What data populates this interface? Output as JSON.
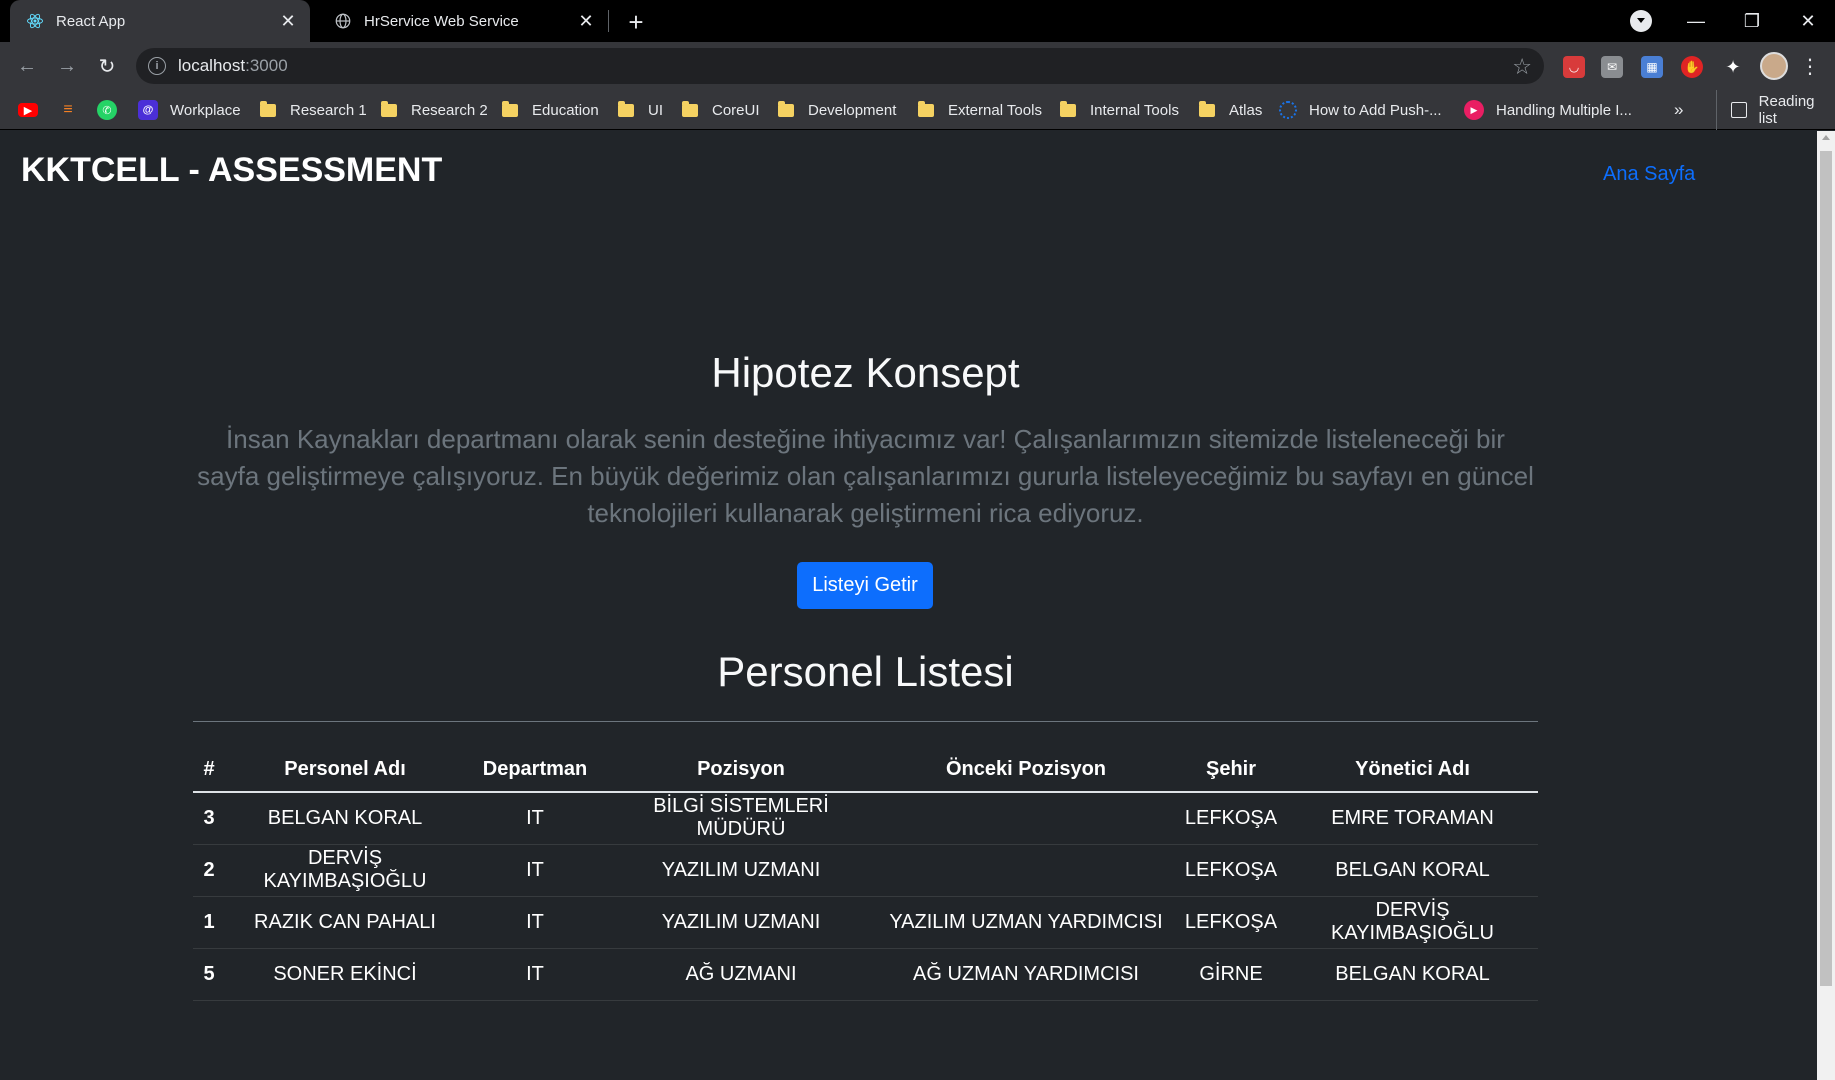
{
  "browser": {
    "tabs": [
      {
        "title": "React App",
        "active": true,
        "icon": "react-icon"
      },
      {
        "title": "HrService Web Service",
        "active": false,
        "icon": "globe-icon"
      }
    ],
    "url_host": "localhost",
    "url_port": ":3000",
    "bookmarks": [
      {
        "label": "",
        "icon": "youtube-icon",
        "color": "#ff0000"
      },
      {
        "label": "",
        "icon": "stackoverflow-icon",
        "color": "#f48024"
      },
      {
        "label": "",
        "icon": "whatsapp-icon",
        "color": "#25d366"
      },
      {
        "label": "Workplace",
        "icon": "workplace-icon",
        "color": "#4b2fd8"
      },
      {
        "label": "Research 1",
        "icon": "folder-icon"
      },
      {
        "label": "Research 2",
        "icon": "folder-icon"
      },
      {
        "label": "Education",
        "icon": "folder-icon"
      },
      {
        "label": "UI",
        "icon": "folder-icon"
      },
      {
        "label": "CoreUI",
        "icon": "folder-icon"
      },
      {
        "label": "Development",
        "icon": "folder-icon"
      },
      {
        "label": "External Tools",
        "icon": "folder-icon"
      },
      {
        "label": "Internal Tools",
        "icon": "folder-icon"
      },
      {
        "label": "Atlas",
        "icon": "folder-icon"
      },
      {
        "label": "How to Add Push-...",
        "icon": "spinner-icon",
        "color": "#1a73e8"
      },
      {
        "label": "Handling Multiple I...",
        "icon": "play-icon",
        "color": "#e91e63"
      }
    ],
    "bookmarks_more": "»",
    "reading_list": "Reading list"
  },
  "page": {
    "brand": "KKTCELL - ASSESSMENT",
    "nav_home": "Ana Sayfa",
    "hero_title": "Hipotez Konsept",
    "hero_text": "İnsan Kaynakları departmanı olarak senin desteğine ihtiyacımız var! Çalışanlarımızın sitemizde listeleneceği bir sayfa geliştirmeye çalışıyoruz. En büyük değerimiz olan çalışanlarımızı gururla listeleyeceğimiz bu sayfayı en güncel teknolojileri kullanarak geliştirmeni rica ediyoruz.",
    "fetch_button": "Listeyi Getir",
    "list_title": "Personel Listesi"
  },
  "table": {
    "headers": [
      "#",
      "Personel Adı",
      "Departman",
      "Pozisyon",
      "Önceki Pozisyon",
      "Şehir",
      "Yönetici Adı"
    ],
    "rows": [
      [
        "3",
        "BELGAN KORAL",
        "IT",
        "BİLGİ SİSTEMLERİ MÜDÜRÜ",
        "",
        "LEFKOŞA",
        "EMRE TORAMAN"
      ],
      [
        "2",
        "DERVİŞ KAYIMBAŞIOĞLU",
        "IT",
        "YAZILIM UZMANI",
        "",
        "LEFKOŞA",
        "BELGAN KORAL"
      ],
      [
        "1",
        "RAZIK CAN PAHALI",
        "IT",
        "YAZILIM UZMANI",
        "YAZILIM UZMAN YARDIMCISI",
        "LEFKOŞA",
        "DERVİŞ KAYIMBAŞIOĞLU"
      ],
      [
        "5",
        "SONER EKİNCİ",
        "IT",
        "AĞ UZMANI",
        "AĞ UZMAN YARDIMCISI",
        "GİRNE",
        "BELGAN KORAL"
      ]
    ]
  },
  "colors": {
    "page_bg": "#212529",
    "primary": "#0d6efd",
    "muted_text": "#6c757d"
  }
}
